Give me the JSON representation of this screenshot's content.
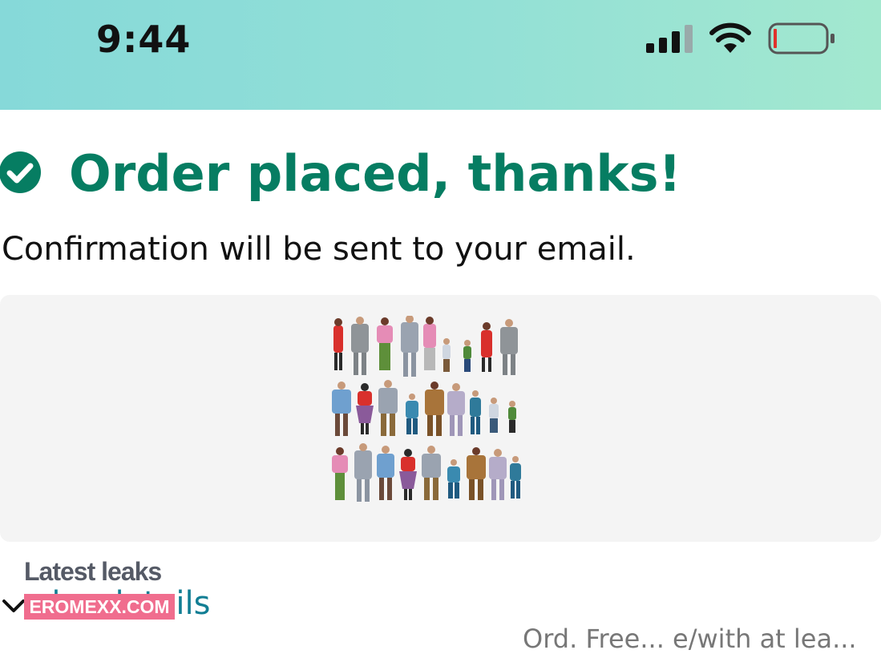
{
  "status_bar": {
    "time": "9:44",
    "signal_icon": "cellular-signal-icon",
    "wifi_icon": "wifi-icon",
    "battery_icon": "battery-low-icon",
    "background_colors": [
      "#86d9d9",
      "#a3e8cf"
    ]
  },
  "confirmation": {
    "icon": "check-circle-icon",
    "headline": "Order placed, thanks!",
    "subline": "Confirmation will be sent to your email.",
    "accent_color": "#067d62"
  },
  "product": {
    "image_icon": "miniature-people-figures-image"
  },
  "watermark": {
    "caption": "Latest leaks",
    "badge": "EROMEXX.COM"
  },
  "order_details": {
    "icon": "chevron-down-icon",
    "label": "der details",
    "link_color": "#117e94"
  },
  "footer": {
    "text": "Ord. Free... e/with at lea..."
  }
}
